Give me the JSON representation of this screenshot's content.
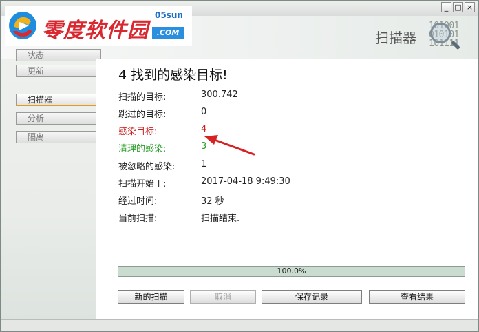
{
  "window": {
    "title": "",
    "minimize_glyph": "_",
    "maximize_glyph": "□",
    "close_glyph": "×"
  },
  "header": {
    "section_title": "扫描器",
    "binary_deco": "101001\n010101\n101111"
  },
  "watermark": {
    "brand_text": "零度软件园",
    "domain_top": "05sun",
    "domain_bottom": ".COM"
  },
  "sidebar": {
    "items": [
      {
        "label": "状态",
        "active": false
      },
      {
        "label": "更新",
        "active": false
      },
      {
        "label": "扫描器",
        "active": true
      },
      {
        "label": "分析",
        "active": false
      },
      {
        "label": "隔离",
        "active": false
      }
    ]
  },
  "results": {
    "headline": "4 找到的感染目标!",
    "rows": [
      {
        "label": "扫描的目标:",
        "value": "300.742",
        "color": "#222222"
      },
      {
        "label": "跳过的目标:",
        "value": "0",
        "color": "#222222"
      },
      {
        "label": "感染目标:",
        "value": "4",
        "color": "#cc1f1f"
      },
      {
        "label": "清理的感染:",
        "value": "3",
        "color": "#2e9e2e"
      },
      {
        "label": "被忽略的感染:",
        "value": "1",
        "color": "#222222"
      },
      {
        "label": "扫描开始于:",
        "value": "2017-04-18 9:49:30",
        "color": "#222222"
      },
      {
        "label": "经过时间:",
        "value": "32 秒",
        "color": "#222222"
      },
      {
        "label": "当前扫描:",
        "value": "扫描结束.",
        "color": "#222222"
      }
    ]
  },
  "progress": {
    "percent": 100,
    "label": "100.0%"
  },
  "actions": {
    "new_scan": "新的扫描",
    "cancel": "取消",
    "save_log": "保存记录",
    "view_results": "查看结果"
  },
  "colors": {
    "infected": "#cc1f1f",
    "cleaned": "#2e9e2e",
    "active_tab_accent": "#e39b1e",
    "progress_fill": "#c9dccf"
  }
}
